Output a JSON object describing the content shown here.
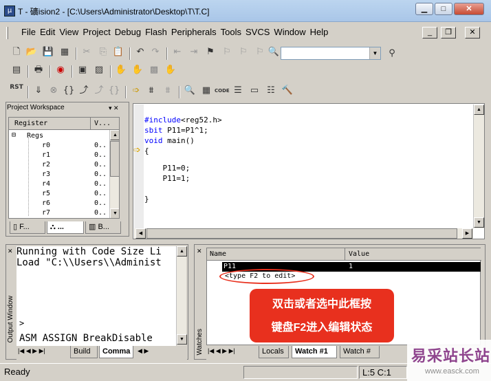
{
  "window": {
    "title": "T  - 礦ision2 - [C:\\Users\\Administrator\\Desktop\\T\\T.C]",
    "icon_glyph": "μ",
    "controls": {
      "minimize": "▁",
      "maximize": "□",
      "close": "✕"
    }
  },
  "menu": {
    "items": [
      "File",
      "Edit",
      "View",
      "Project",
      "Debug",
      "Flash",
      "Peripherals",
      "Tools",
      "SVCS",
      "Window",
      "Help"
    ],
    "mdi_controls": {
      "minimize": "_",
      "restore": "❐",
      "close": "✕"
    }
  },
  "toolbar": {
    "combo_value": "",
    "combo_arrow": "▼",
    "row3_first_label": "RST"
  },
  "workspace": {
    "title": "Project Workspace",
    "title_controls": "▾ ✕",
    "columns": [
      "Register",
      "V..."
    ],
    "group": "Regs",
    "registers": [
      {
        "name": "r0",
        "value": "0.."
      },
      {
        "name": "r1",
        "value": "0.."
      },
      {
        "name": "r2",
        "value": "0.."
      },
      {
        "name": "r3",
        "value": "0.."
      },
      {
        "name": "r4",
        "value": "0.."
      },
      {
        "name": "r5",
        "value": "0.."
      },
      {
        "name": "r6",
        "value": "0.."
      },
      {
        "name": "r7",
        "value": "0.."
      }
    ],
    "tabs": [
      "F...",
      "...",
      "B..."
    ]
  },
  "editor": {
    "lines": [
      {
        "pre": "#include",
        "rest": "<reg52.h>"
      },
      {
        "pre": "sbit",
        "rest": " P11=P1^1;"
      },
      {
        "pre": "void",
        "rest": " main()"
      },
      {
        "pre": "",
        "rest": "{"
      },
      {
        "pre": "",
        "rest": "    P11=0;"
      },
      {
        "pre": "",
        "rest": "    P11=1;"
      },
      {
        "pre": "",
        "rest": ""
      },
      {
        "pre": "",
        "rest": "}"
      }
    ],
    "arrow_glyph": "➩"
  },
  "output": {
    "label": "Output Window",
    "lines": [
      "Running with Code Size Li",
      "Load \"C:\\\\Users\\\\Administ"
    ],
    "prompt": ">",
    "command": "ASM ASSIGN BreakDisable",
    "tabs": [
      "Build",
      "Comma"
    ]
  },
  "watches": {
    "label": "Watches",
    "columns": [
      "Name",
      "Value"
    ],
    "rows": [
      {
        "name": "P11",
        "value": "1"
      },
      {
        "name": "<type F2 to edit>",
        "value": ""
      }
    ],
    "tabs": [
      "Locals",
      "Watch #1",
      "Watch #"
    ]
  },
  "callout": {
    "line1": "双击或者选中此框按",
    "line2": "键盘F2进入编辑状态"
  },
  "statusbar": {
    "left": "Ready",
    "right": "L:5 C:1"
  },
  "watermark": {
    "text": "易采站长站",
    "url": "www.easck.com"
  },
  "colors": {
    "titlebar": "#a9c6e8",
    "callout": "#e8301e",
    "highlight_ellipse": "#e8301e",
    "keyword": "#0000ff"
  }
}
